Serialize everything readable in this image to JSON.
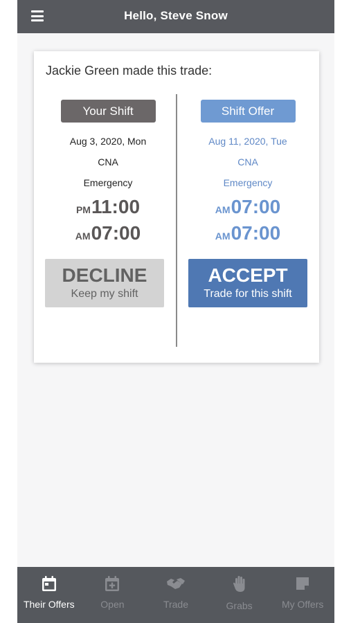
{
  "header": {
    "title": "Hello, Steve Snow"
  },
  "trade": {
    "heading": "Jackie Green made this trade:",
    "your_shift": {
      "label": "Your Shift",
      "date": "Aug 3, 2020, Mon",
      "role": "CNA",
      "department": "Emergency",
      "start_ampm": "PM",
      "start_time": "11:00",
      "end_ampm": "AM",
      "end_time": "07:00"
    },
    "shift_offer": {
      "label": "Shift Offer",
      "date": "Aug 11, 2020, Tue",
      "role": "CNA",
      "department": "Emergency",
      "start_ampm": "AM",
      "start_time": "07:00",
      "end_ampm": "AM",
      "end_time": "07:00"
    },
    "decline": {
      "title": "DECLINE",
      "subtitle": "Keep my shift"
    },
    "accept": {
      "title": "ACCEPT",
      "subtitle": "Trade for this shift"
    }
  },
  "tabs": [
    {
      "label": "Their Offers",
      "icon": "calendar-icon",
      "active": true
    },
    {
      "label": "Open",
      "icon": "calendar-plus-icon",
      "active": false
    },
    {
      "label": "Trade",
      "icon": "handshake-icon",
      "active": false
    },
    {
      "label": "Grabs",
      "icon": "hand-icon",
      "active": false
    },
    {
      "label": "My Offers",
      "icon": "note-icon",
      "active": false
    }
  ],
  "colors": {
    "header_bg": "#57595e",
    "your_shift_pill": "#6b6768",
    "shift_offer_pill": "#6f9ad2",
    "accept_button": "#4f78b3",
    "decline_button": "#d3d3d3"
  }
}
